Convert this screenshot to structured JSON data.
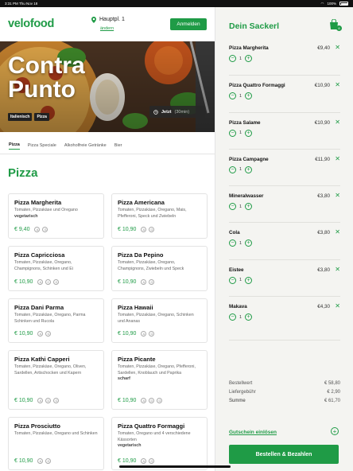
{
  "status_bar": {
    "time": "3:31 PM",
    "date": "Thu Nov 18",
    "battery": "100%"
  },
  "header": {
    "logo": "velofood",
    "location": "Hauptpl. 1",
    "location_change": "ändern",
    "login_label": "Anmelden"
  },
  "restaurant": {
    "name": "Contra Punto",
    "tags": [
      "Italienisch",
      "Pizza"
    ],
    "delivery_time_label": "Jetzt",
    "delivery_time_detail": "(30min)"
  },
  "categories": [
    "Pizza",
    "Pizza Speciale",
    "Alkoholfreie Getränke",
    "Bier"
  ],
  "active_category": "Pizza",
  "section_title": "Pizza",
  "menu": [
    {
      "name": "Pizza Margherita",
      "desc": "Tomaten, Pizzakäse und Oregano",
      "veg": "vegetarisch",
      "price": "€ 9,40",
      "allergens": [
        "A",
        "G"
      ]
    },
    {
      "name": "Pizza Americana",
      "desc": "Tomaten, Pizzakäse, Oregano, Mais, Pfefferoni, Speck und Zwiebeln",
      "veg": "",
      "price": "€ 10,90",
      "allergens": [
        "A",
        "G"
      ]
    },
    {
      "name": "Pizza Capricciosa",
      "desc": "Tomaten, Pizzakäse, Oregano, Champignons, Schinken und Ei",
      "veg": "",
      "price": "€ 10,90",
      "allergens": [
        "A",
        "C",
        "G"
      ]
    },
    {
      "name": "Pizza Da Pepino",
      "desc": "Tomaten, Pizzakäse, Oregano, Champignons, Zwiebeln und Speck",
      "veg": "",
      "price": "€ 10,90",
      "allergens": [
        "A",
        "G"
      ]
    },
    {
      "name": "Pizza Dani Parma",
      "desc": "Tomaten, Pizzakäse, Oregano, Parma Schinken und Rucola",
      "veg": "",
      "price": "€ 10,90",
      "allergens": [
        "A",
        "G"
      ]
    },
    {
      "name": "Pizza Hawaii",
      "desc": "Tomaten, Pizzakäse, Oregano, Schinken und Ananas",
      "veg": "",
      "price": "€ 10,90",
      "allergens": [
        "A",
        "G"
      ]
    },
    {
      "name": "Pizza Kathi Capperi",
      "desc": "Tomaten, Pizzakäse, Oregano, Oliven, Sardellen, Artischocken und Kapern",
      "veg": "",
      "price": "€ 10,90",
      "allergens": [
        "A",
        "D",
        "G"
      ]
    },
    {
      "name": "Pizza Picante",
      "desc": "Tomaten, Pizzakäse, Oregano, Pfefferoni, Sardellen, Knoblauch und Paprika",
      "veg": "scharf",
      "price": "€ 10,90",
      "allergens": [
        "A",
        "D",
        "G"
      ]
    },
    {
      "name": "Pizza Prosciutto",
      "desc": "Tomaten, Pizzakäse, Oregano und Schinken",
      "veg": "",
      "price": "€ 10,90",
      "allergens": [
        "A",
        "G"
      ]
    },
    {
      "name": "Pizza Quattro Formaggi",
      "desc": "Tomaten, Oregano und 4 verschiedene Kässorten",
      "veg": "vegetarisch",
      "price": "€ 10,90",
      "allergens": [
        "A",
        "G"
      ]
    }
  ],
  "cart": {
    "title": "Dein Sackerl",
    "count": "8",
    "items": [
      {
        "name": "Pizza Margherita",
        "price": "€9,40",
        "qty": "1"
      },
      {
        "name": "Pizza Quattro Formaggi",
        "price": "€10,90",
        "qty": "1"
      },
      {
        "name": "Pizza Salame",
        "price": "€10,90",
        "qty": "1"
      },
      {
        "name": "Pizza Campagne",
        "price": "€11,90",
        "qty": "1"
      },
      {
        "name": "Mineralwasser",
        "price": "€3,80",
        "qty": "1"
      },
      {
        "name": "Cola",
        "price": "€3,80",
        "qty": "1"
      },
      {
        "name": "Eistee",
        "price": "€3,80",
        "qty": "1"
      },
      {
        "name": "Makava",
        "price": "€4,30",
        "qty": "1"
      }
    ],
    "subtotal_label": "Bestellwert",
    "subtotal": "€ 58,80",
    "delivery_label": "Liefergebühr",
    "delivery": "€ 2,90",
    "total_label": "Summe",
    "total": "€ 61,70",
    "coupon_label": "Gutschein einlösen",
    "order_label": "Bestellen & Bezahlen"
  },
  "colors": {
    "brand": "#1f9b46"
  }
}
